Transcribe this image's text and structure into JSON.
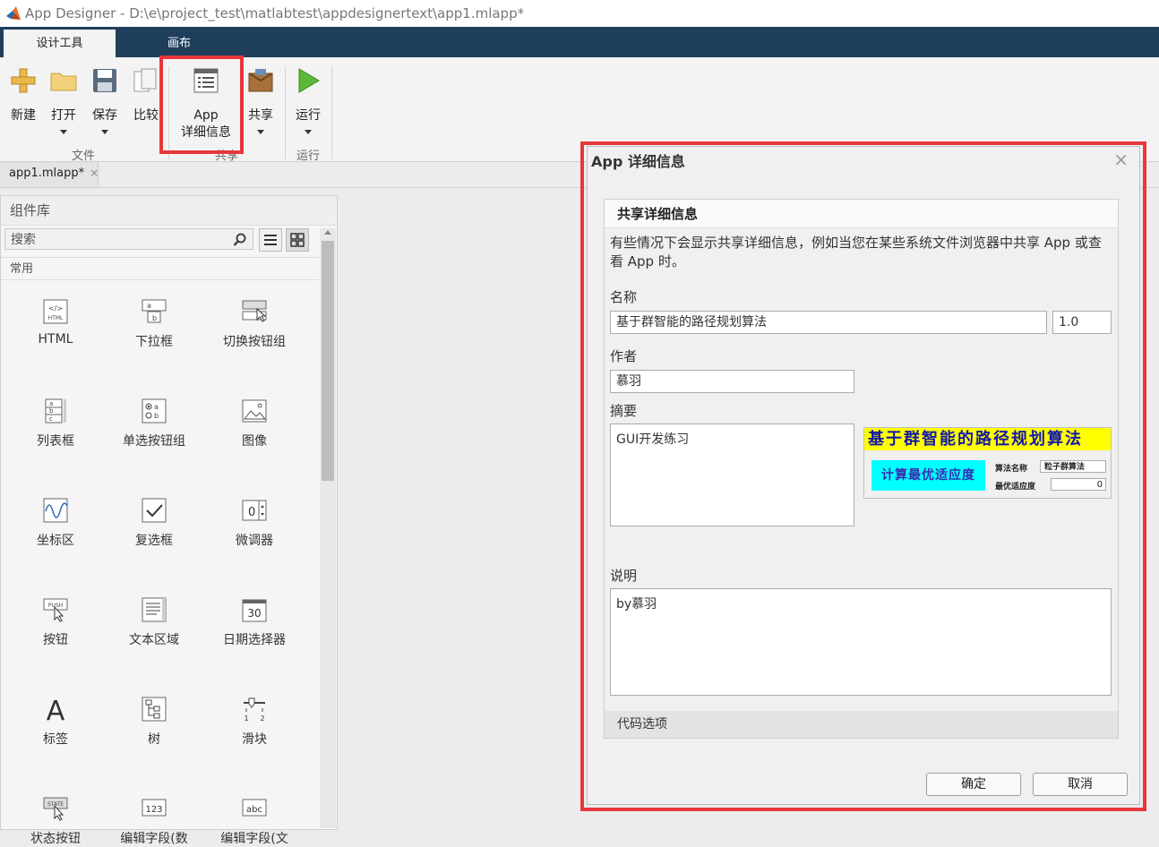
{
  "window": {
    "title": "App Designer - D:\\e\\project_test\\matlabtest\\appdesignertext\\app1.mlapp*"
  },
  "toolstrip_tabs": [
    "设计工具",
    "画布"
  ],
  "ribbon": {
    "buttons": {
      "new": "新建",
      "open": "打开",
      "save": "保存",
      "compare": "比较",
      "app_details_line1": "App",
      "app_details_line2": "详细信息",
      "share": "共享",
      "run": "运行"
    },
    "groups": {
      "file": "文件",
      "share": "共享",
      "run": "运行"
    }
  },
  "doc_tab": {
    "label": "app1.mlapp*",
    "close": "×"
  },
  "library": {
    "title": "组件库",
    "search_placeholder": "搜索",
    "section": "常用",
    "components": [
      "HTML",
      "下拉框",
      "切换按钮组",
      "列表框",
      "单选按钮组",
      "图像",
      "坐标区",
      "复选框",
      "微调器",
      "按钮",
      "文本区域",
      "日期选择器",
      "标签",
      "树",
      "滑块",
      "状态按钮",
      "编辑字段(数",
      "编辑字段(文"
    ]
  },
  "dialog": {
    "title": "App 详细信息",
    "close": "×",
    "panel_title": "共享详细信息",
    "description": "有些情况下会显示共享详细信息，例如当您在某些系统文件浏览器中共享 App 或查看 App 时。",
    "name_label": "名称",
    "name_value": "基于群智能的路径规划算法",
    "version_value": "1.0",
    "author_label": "作者",
    "author_value": "慕羽",
    "summary_label": "摘要",
    "summary_value": "GUI开发练习",
    "notes_label": "说明",
    "notes_value": "by慕羽",
    "code_options": "代码选项",
    "ok": "确定",
    "cancel": "取消",
    "screenshot": {
      "banner": "基于群智能的路径规划算法",
      "button": "计算最优适应度",
      "label_algo": "算法名称",
      "algo_value": "粒子群算法",
      "label_fit": "最优适应度",
      "fit_value": "0"
    }
  },
  "colors": {
    "tabstrip": "#1f3e5c",
    "highlight": "#e8373c"
  }
}
